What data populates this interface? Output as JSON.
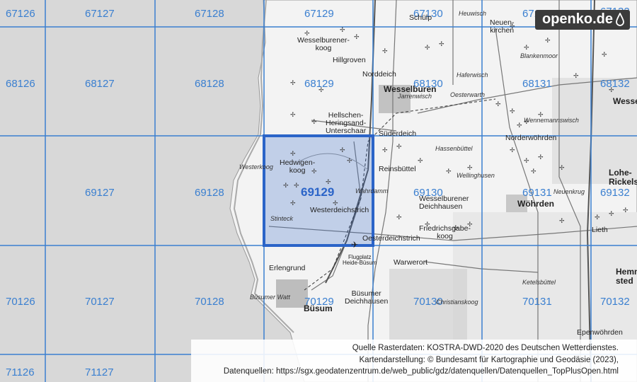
{
  "map": {
    "logo_text": "openko.de",
    "logo_icon": "water-drop-icon",
    "highlight_color": "#2b64c8",
    "grid_line_color": "#3a7fd0",
    "highlight_label": "69129",
    "grid_labels": [
      "67126",
      "67127",
      "67128",
      "67129",
      "67130",
      "67131",
      "67132",
      "68126",
      "68127",
      "68128",
      "68129",
      "68130",
      "68131",
      "68132",
      "69127",
      "69128",
      "69130",
      "69131",
      "69132",
      "70126",
      "70127",
      "70128",
      "70129",
      "70130",
      "70131",
      "70132",
      "71126",
      "71127"
    ],
    "places": {
      "town": [
        "Wesselburen",
        "Wöhrden",
        "Büsum",
        "Lohe-\nRickelsh",
        "Wesse",
        "Hemmi\nsted"
      ],
      "place": [
        "Wesselburener-\nkoog",
        "Hillgroven",
        "Norddeich",
        "Hellschen-\nHeringsand-\nUnterschaar",
        "Süderdeich",
        "Hedwigen-\nkoog",
        "Westerdeichstrich",
        "Oesterdeichstrich",
        "Reinsbüttel",
        "Wesselburener\nDeichhausen",
        "Friedrichsgabe-\nkoog",
        "Norderwöhrden",
        "Büsumer\nDeichhausen",
        "Schülp",
        "Neuen-\nkirchen",
        "Lieth",
        "Warwerort",
        "Erlengrund",
        "Epenwöhrden"
      ],
      "hamlet": [
        "Heuwisch",
        "Blankenmoor",
        "Haferwisch",
        "Oesterwarth",
        "Jarrenwisch",
        "Wennemannswisch",
        "Hassenbüttel",
        "Wellinghusen",
        "Neuenkrug",
        "Westerkoog",
        "Stinteck",
        "Wahrdamm",
        "Christianskoog",
        "Ketelsbüttel",
        "Büsumer Watt"
      ],
      "airfield": "Flugplatz\nHeide-Büsum"
    },
    "attribution": [
      "Quelle Rasterdaten: KOSTRA-DWD-2020 des Deutschen Wetterdienstes.",
      "Kartendarstellung: © Bundesamt für Kartographie und Geodäsie (2023),",
      "Datenquellen: https://sgx.geodatenzentrum.de/web_public/gdz/datenquellen/Datenquellen_TopPlusOpen.html"
    ]
  }
}
